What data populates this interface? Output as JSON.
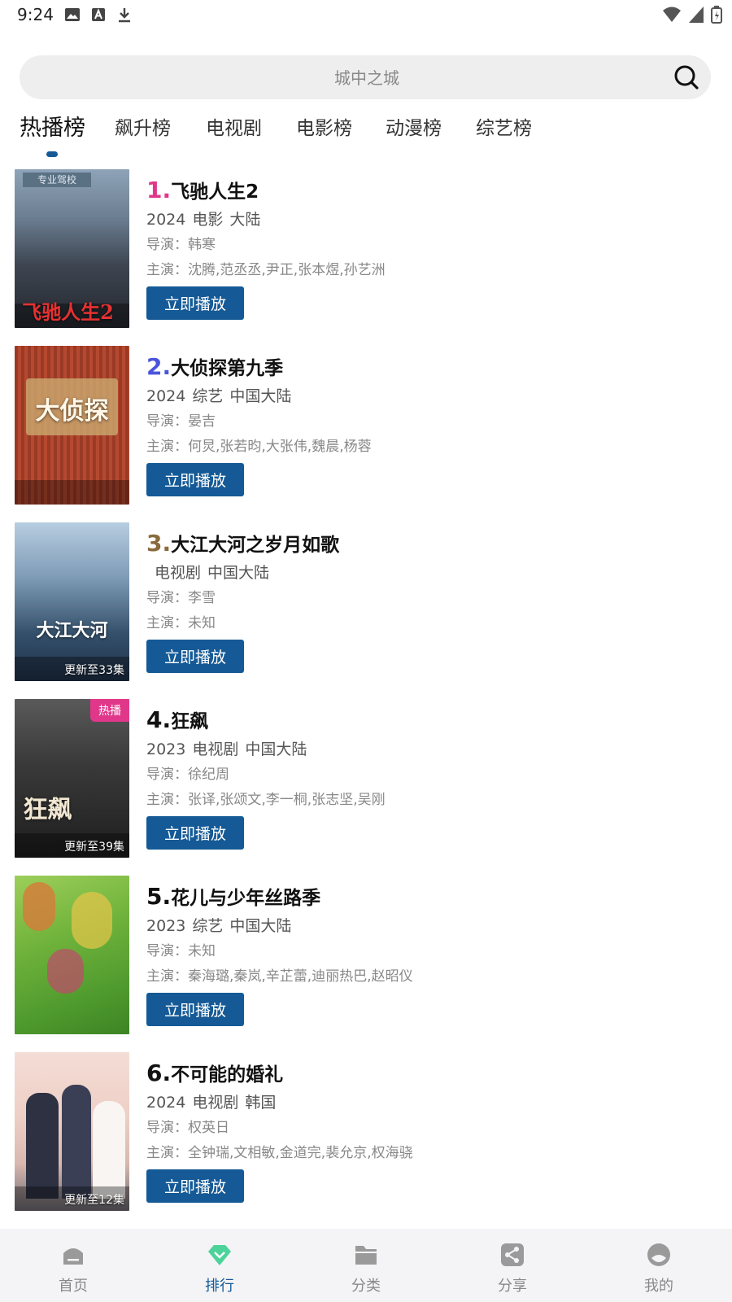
{
  "status_bar": {
    "time": "9:24",
    "left_icons": [
      "image-icon",
      "font-icon",
      "download-icon"
    ],
    "right_icons": [
      "wifi-icon",
      "signal-icon",
      "battery-icon"
    ]
  },
  "search": {
    "placeholder": "城中之城"
  },
  "tabs": [
    {
      "label": "热播榜",
      "active": true
    },
    {
      "label": "飙升榜",
      "active": false
    },
    {
      "label": "电视剧",
      "active": false
    },
    {
      "label": "电影榜",
      "active": false
    },
    {
      "label": "动漫榜",
      "active": false
    },
    {
      "label": "综艺榜",
      "active": false
    }
  ],
  "colors": {
    "accent": "#155a96",
    "rank1": "#e0378a",
    "rank2": "#4a55d9",
    "rank3": "#8a6a3d",
    "hot_badge": "#e0378a",
    "nav_active_icon": "#4cd39a"
  },
  "items": [
    {
      "rank": "1.",
      "title": "飞驰人生2",
      "year": "2024",
      "type": "电影",
      "region": "大陆",
      "director_label": "导演：",
      "director": "韩寒",
      "cast_label": "主演：",
      "cast": "沈腾,范丞丞,尹正,张本煜,孙艺洲",
      "play_label": "立即播放",
      "poster_text": "飞驰人生2",
      "update": "",
      "badge": ""
    },
    {
      "rank": "2.",
      "title": "大侦探第九季",
      "year": "2024",
      "type": "综艺",
      "region": "中国大陆",
      "director_label": "导演：",
      "director": "晏吉",
      "cast_label": "主演：",
      "cast": "何炅,张若昀,大张伟,魏晨,杨蓉",
      "play_label": "立即播放",
      "poster_text": "大侦探",
      "update": "",
      "badge": ""
    },
    {
      "rank": "3.",
      "title": "大江大河之岁月如歌",
      "year": "",
      "type": "电视剧",
      "region": "中国大陆",
      "director_label": "导演：",
      "director": "李雪",
      "cast_label": "主演：",
      "cast": "未知",
      "play_label": "立即播放",
      "poster_text": "大江大河",
      "update": "更新至33集",
      "badge": ""
    },
    {
      "rank": "4.",
      "title": "狂飙",
      "year": "2023",
      "type": "电视剧",
      "region": "中国大陆",
      "director_label": "导演：",
      "director": "徐纪周",
      "cast_label": "主演：",
      "cast": "张译,张颂文,李一桐,张志坚,吴刚",
      "play_label": "立即播放",
      "poster_text": "狂飙",
      "update": "更新至39集",
      "badge": "热播"
    },
    {
      "rank": "5.",
      "title": "花儿与少年丝路季",
      "year": "2023",
      "type": "综艺",
      "region": "中国大陆",
      "director_label": "导演：",
      "director": "未知",
      "cast_label": "主演：",
      "cast": "秦海璐,秦岚,辛芷蕾,迪丽热巴,赵昭仪",
      "play_label": "立即播放",
      "poster_text": "",
      "update": "",
      "badge": ""
    },
    {
      "rank": "6.",
      "title": "不可能的婚礼",
      "year": "2024",
      "type": "电视剧",
      "region": "韩国",
      "director_label": "导演：",
      "director": "权英日",
      "cast_label": "主演：",
      "cast": "全钟瑞,文相敏,金道完,裴允京,权海骁",
      "play_label": "立即播放",
      "poster_text": "",
      "update": "更新至12集",
      "badge": ""
    }
  ],
  "bottom_nav": [
    {
      "label": "首页",
      "icon": "home-icon",
      "active": false
    },
    {
      "label": "排行",
      "icon": "diamond-icon",
      "active": true
    },
    {
      "label": "分类",
      "icon": "folder-icon",
      "active": false
    },
    {
      "label": "分享",
      "icon": "share-icon",
      "active": false
    },
    {
      "label": "我的",
      "icon": "profile-icon",
      "active": false
    }
  ]
}
